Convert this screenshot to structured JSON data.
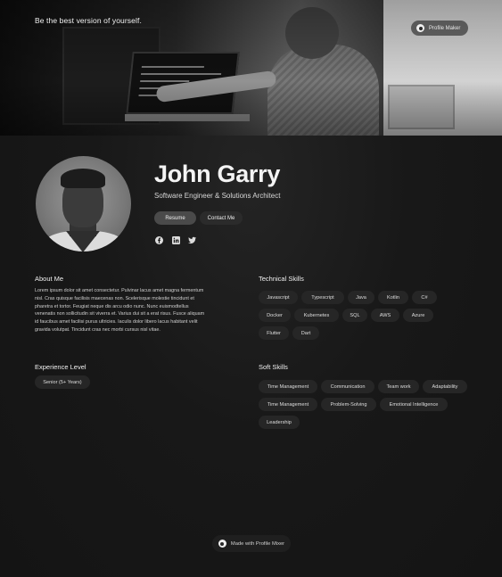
{
  "hero": {
    "tagline": "Be the best version of yourself.",
    "badge_label": "Profile Maker"
  },
  "profile": {
    "name": "John Garry",
    "role": "Software Engineer & Solutions Architect",
    "buttons": {
      "resume": "Resume",
      "contact": "Contact Me"
    },
    "social_icons": [
      "facebook-icon",
      "linkedin-icon",
      "twitter-icon"
    ]
  },
  "about": {
    "title": "About Me",
    "text": "Lorem ipsum dolor sit amet consectetur. Pulvinar lacus amet magna fermentum nisl. Cras quisque facilisis maecenas non. Scelerisque molestie tincidunt et pharetra et tortor. Feugiat neque dis arcu odio nunc. Nunc euismodtellus venenatis non sollicitudin sit viverra et. Varius dui sit a erat risus. Fusce aliquam id faucibus amet facilisi purus ultricies. Iaculis dolor libero lacus habitant velit gravida volutpat. Tincidunt cras nec morbi cursus nisl vitae."
  },
  "technical_skills": {
    "title": "Technical Skills",
    "items": [
      "Javascript",
      "Typescript",
      "Java",
      "Kotlin",
      "C#",
      "Docker",
      "Kubernetes",
      "SQL",
      "AWS",
      "Azure",
      "Flutter",
      "Dart"
    ]
  },
  "experience": {
    "title": "Experience Level",
    "value": "Senior (5+ Years)"
  },
  "soft_skills": {
    "title": "Soft Skills",
    "items": [
      "Time Management",
      "Communication",
      "Team work",
      "Adaptability",
      "Time Management",
      "Problem-Solving",
      "Emotional Intelligence",
      "Leadership"
    ]
  },
  "footer": {
    "badge_label": "Made with Profile Mixer"
  },
  "colors": {
    "background": "#161616",
    "chip": "#262626",
    "primary_button": "#4a4a4a",
    "text": "#f0f0f0"
  }
}
